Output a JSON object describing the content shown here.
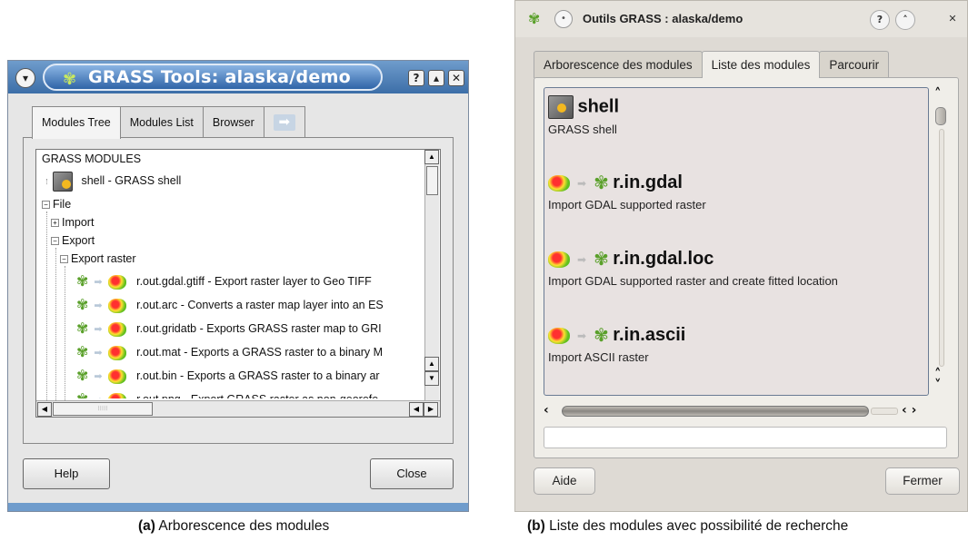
{
  "left": {
    "title": "GRASS Tools: alaska/demo",
    "tabs": [
      "Modules Tree",
      "Modules List",
      "Browser"
    ],
    "tree": {
      "root": "GRASS MODULES",
      "shell": "shell - GRASS shell",
      "file": "File",
      "import": "Import",
      "export": "Export",
      "export_raster": "Export raster",
      "modules": [
        "r.out.gdal.gtiff - Export raster layer to Geo TIFF",
        "r.out.arc - Converts a raster map layer into an ES",
        "r.out.gridatb - Exports GRASS raster map to GRI",
        "r.out.mat - Exports a GRASS raster to a binary M",
        "r.out.bin - Exports a GRASS raster to a binary ar",
        "r.out.png - Export GRASS raster as non-georefe"
      ]
    },
    "help_label": "Help",
    "close_label": "Close"
  },
  "right": {
    "title": "Outils GRASS : alaska/demo",
    "tabs": [
      "Arborescence des modules",
      "Liste des modules",
      "Parcourir"
    ],
    "modules": [
      {
        "name": "shell",
        "desc": "GRASS shell"
      },
      {
        "name": "r.in.gdal",
        "desc": "Import GDAL supported raster"
      },
      {
        "name": "r.in.gdal.loc",
        "desc": "Import GDAL supported raster and create fitted location"
      },
      {
        "name": "r.in.ascii",
        "desc": "Import ASCII raster"
      }
    ],
    "search_value": "",
    "aide_label": "Aide",
    "fermer_label": "Fermer"
  },
  "captions": {
    "a_label": "(a)",
    "a_text": " Arborescence des modules",
    "b_label": "(b)",
    "b_text": " Liste des modules avec possibilité de recherche"
  }
}
